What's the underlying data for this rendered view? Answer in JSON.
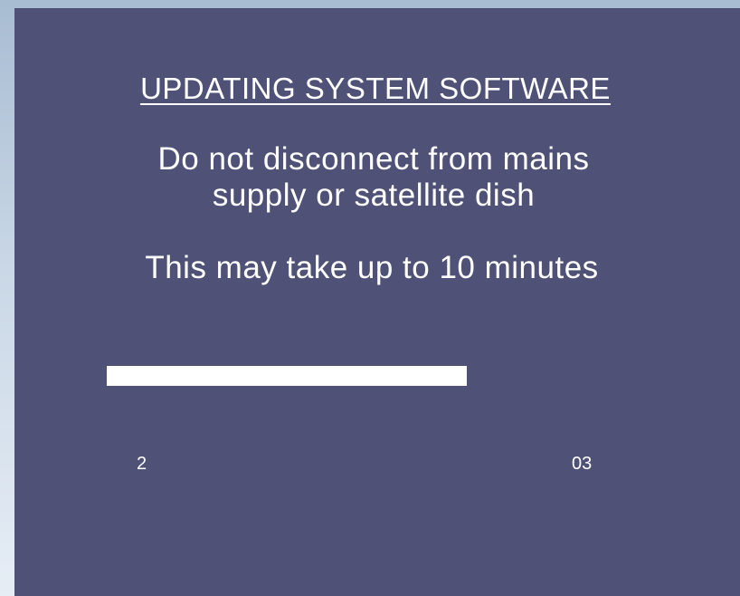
{
  "screen": {
    "title": "UPDATING SYSTEM SOFTWARE",
    "warning_line_1": "Do not disconnect from mains",
    "warning_line_2": "supply or satellite dish",
    "duration_note": "This may take up to 10 minutes",
    "background_color": "#4f5276",
    "text_color": "#ffffff"
  },
  "progress": {
    "fraction": 0.75,
    "bar_color": "#ffffff"
  },
  "counters": {
    "left": "2",
    "right": "03"
  }
}
